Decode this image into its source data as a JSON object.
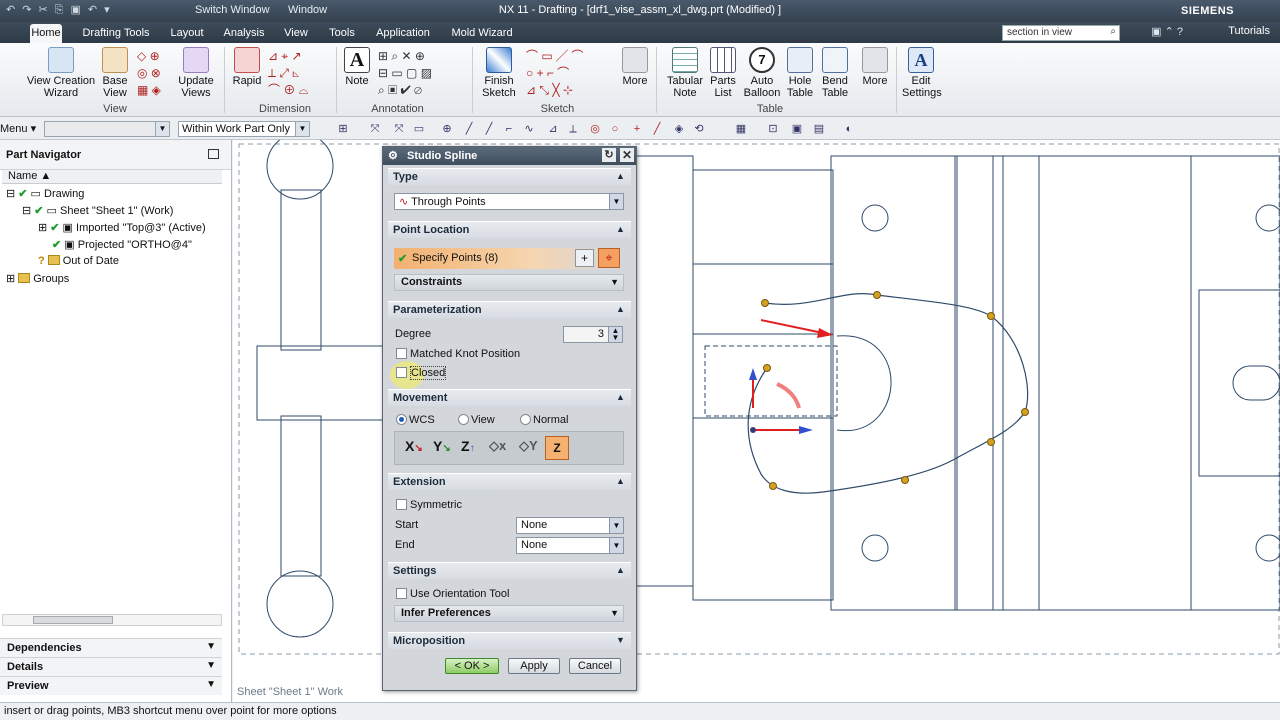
{
  "titlebar": {
    "title": "NX 11 - Drafting - [drf1_vise_assm_xl_dwg.prt (Modified) ]",
    "brand": "SIEMENS",
    "switch_window": "Switch Window",
    "window_menu": "Window"
  },
  "tabs": [
    "Home",
    "Drafting Tools",
    "Layout",
    "Analysis",
    "View",
    "Tools",
    "Application",
    "Mold Wizard"
  ],
  "search_placeholder": "section in view",
  "tutorials": "Tutorials",
  "ribbon": {
    "view_creation_wizard": "View Creation Wizard",
    "base_view": "Base View",
    "update_views": "Update Views",
    "group_view": "View",
    "rapid": "Rapid",
    "group_dimension": "Dimension",
    "note": "Note",
    "group_annotation": "Annotation",
    "finish_sketch": "Finish Sketch",
    "group_sketch": "Sketch",
    "more": "More",
    "tabular_note": "Tabular Note",
    "parts_list": "Parts List",
    "auto_balloon": "Auto Balloon",
    "hole_table": "Hole Table",
    "bend_table": "Bend Table",
    "group_table": "Table",
    "edit_settings": "Edit Settings"
  },
  "toolbar": {
    "menu": "Menu",
    "filter": "Within Work Part Only"
  },
  "navigator": {
    "title": "Part Navigator",
    "col_name": "Name",
    "items": [
      "Drawing",
      "Sheet \"Sheet 1\" (Work)",
      "Imported \"Top@3\" (Active)",
      "Projected \"ORTHO@4\"",
      "Out of Date",
      "Groups"
    ],
    "panels": [
      "Dependencies",
      "Details",
      "Preview"
    ]
  },
  "canvas": {
    "sheet_label": "Sheet \"Sheet 1\" Work"
  },
  "dialog": {
    "title": "Studio Spline",
    "type_section": "Type",
    "type_value": "Through Points",
    "point_location": "Point Location",
    "specify_points": "Specify Points (8)",
    "constraints": "Constraints",
    "parameterization": "Parameterization",
    "degree_label": "Degree",
    "degree_value": "3",
    "matched_knot": "Matched Knot Position",
    "closed": "Closed",
    "movement": "Movement",
    "wcs": "WCS",
    "view": "View",
    "normal": "Normal",
    "extension": "Extension",
    "symmetric": "Symmetric",
    "start_label": "Start",
    "start_value": "None",
    "end_label": "End",
    "end_value": "None",
    "settings": "Settings",
    "use_orientation": "Use Orientation Tool",
    "infer_preferences": "Infer Preferences",
    "microposition": "Microposition",
    "ok": "< OK >",
    "apply": "Apply",
    "cancel": "Cancel"
  },
  "status_text": "insert or drag points, MB3 shortcut menu over point for more options"
}
